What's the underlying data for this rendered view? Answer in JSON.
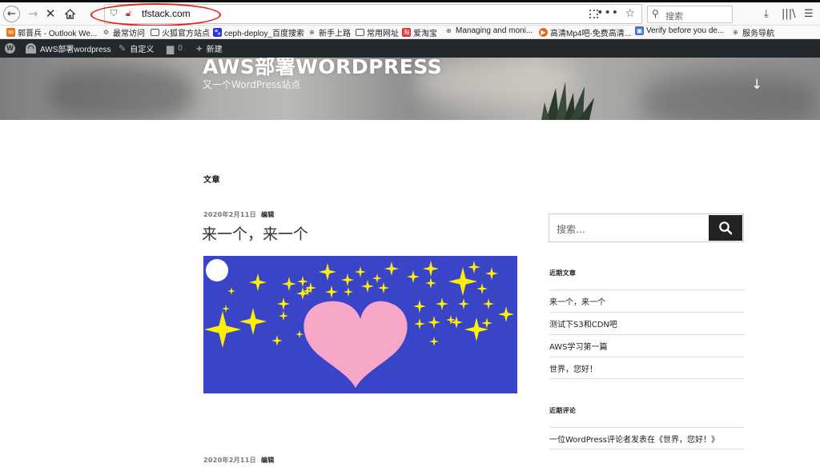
{
  "browser": {
    "url": "tfstack.com",
    "search_placeholder": "搜索",
    "bookmarks": [
      {
        "label": "郭晋兵 - Outlook We...",
        "icon": "outlook-icon",
        "color": "#e0791a"
      },
      {
        "label": "最常访问",
        "icon": "gear-icon",
        "color": "#555555"
      },
      {
        "label": "火狐官方站点",
        "icon": "folder-icon",
        "color": "#555555"
      },
      {
        "label": "ceph-deploy_百度搜索",
        "icon": "baidu-icon",
        "color": "#2932e1"
      },
      {
        "label": "新手上路",
        "icon": "globe-icon",
        "color": "#555555"
      },
      {
        "label": "常用网址",
        "icon": "folder-icon",
        "color": "#555555"
      },
      {
        "label": "爱淘宝",
        "icon": "taobao-icon",
        "color": "#e0303e"
      },
      {
        "label": "Managing and moni...",
        "icon": "globe-icon",
        "color": "#555555"
      },
      {
        "label": "高清Mp4吧-免费高清...",
        "icon": "play-icon",
        "color": "#e06a1a"
      },
      {
        "label": "Verify before you de...",
        "icon": "image-icon",
        "color": "#3f6fc5"
      },
      {
        "label": "服务导航",
        "icon": "globe-icon",
        "color": "#555555"
      }
    ]
  },
  "adminbar": {
    "site_name": "AWS部署wordpress",
    "customize": "自定义",
    "comments_count": "0",
    "new": "新建"
  },
  "header": {
    "site_title": "AWS部署WORDPRESS",
    "site_description": "又一个WordPress站点"
  },
  "main": {
    "page_heading": "文章",
    "posts": [
      {
        "date": "2020年2月11日",
        "edit": "编辑",
        "title": "来一个，来一个"
      },
      {
        "date": "2020年2月11日",
        "edit": "编辑",
        "title": ""
      }
    ]
  },
  "sidebar": {
    "search_placeholder": "搜索…",
    "recent_posts_title": "近期文章",
    "recent_posts": [
      "来一个，来一个",
      "测试下S3和CDN吧",
      "AWS学习第一篇",
      "世界，您好！"
    ],
    "recent_comments_title": "近期评论",
    "recent_comments": [
      "一位WordPress评论者发表在《世界，您好！》"
    ]
  },
  "colors": {
    "image_background": "#3a44c6",
    "heart": "#f7a8c8",
    "stars": "#ffef00",
    "admin_bar": "#23282d",
    "annotation_circle": "#e0241a"
  }
}
